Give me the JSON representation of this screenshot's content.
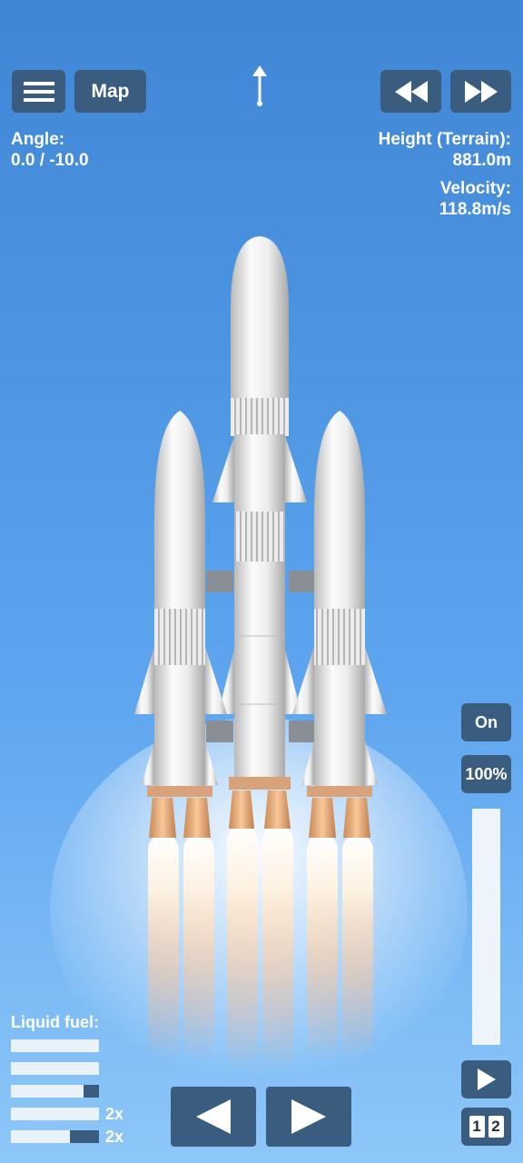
{
  "header": {
    "map_label": "Map",
    "menu_icon": "hamburger-icon",
    "direction_icon": "up-arrow-icon",
    "rewind_icon": "rewind-icon",
    "fast_forward_icon": "fast-forward-icon"
  },
  "telemetry": {
    "angle_label": "Angle:",
    "angle_value": "0.0 / -10.0",
    "height_label": "Height (Terrain):",
    "height_value": "881.0m",
    "velocity_label": "Velocity:",
    "velocity_value": "118.8m/s"
  },
  "throttle": {
    "engine_toggle_label": "On",
    "percent_label": "100%",
    "level": 1.0
  },
  "fuel": {
    "label": "Liquid fuel:",
    "tanks": [
      {
        "level": 1.0,
        "multiplier": ""
      },
      {
        "level": 1.0,
        "multiplier": ""
      },
      {
        "level": 0.82,
        "multiplier": ""
      },
      {
        "level": 1.0,
        "multiplier": "2x"
      },
      {
        "level": 0.67,
        "multiplier": "2x"
      }
    ]
  },
  "controls": {
    "rotate_left_icon": "left-triangle-icon",
    "rotate_right_icon": "right-triangle-icon",
    "stage_icon": "play-icon",
    "view_icon": "camera-view-icon",
    "view_labels": [
      "1",
      "2"
    ]
  },
  "colors": {
    "button_bg": "#3a5c7e",
    "sky_top": "#3f86d6",
    "sky_bottom": "#8ec7f8",
    "flame": "#ffb070"
  }
}
